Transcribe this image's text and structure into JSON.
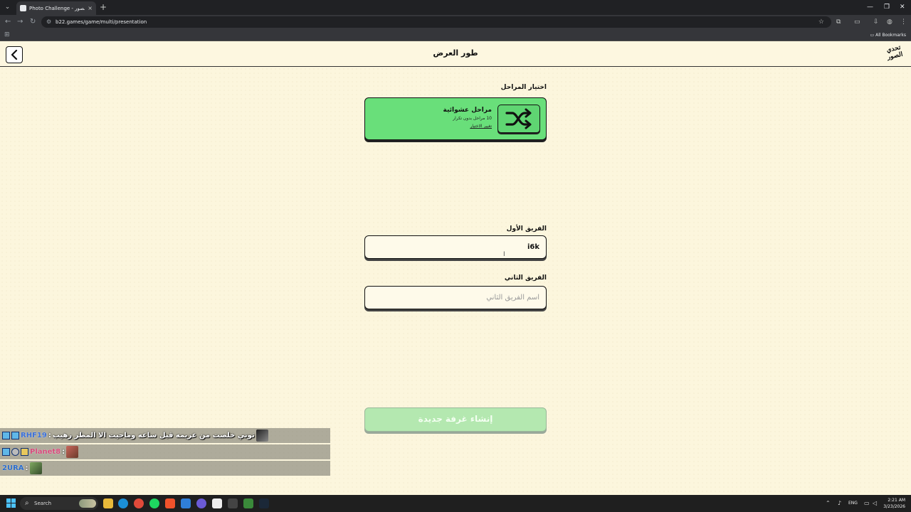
{
  "browser": {
    "tab_title": "Photo Challenge - تحدي الصور",
    "tab_close": "×",
    "new_tab": "+",
    "url": "b22.games/game/multi/presentation",
    "all_bookmarks": "All Bookmarks"
  },
  "header": {
    "title": "طور العرض",
    "logo_text": "تحدي الصور"
  },
  "levels": {
    "label": "اختيار المراحل",
    "card_title": "مراحل عشوائية",
    "card_subtitle": "10 مراحل بدون تكرار",
    "card_link": "تغيير الاختيار"
  },
  "team1": {
    "label": "الفريق الأول",
    "value": "i6k"
  },
  "team2": {
    "label": "الفريق الثاني",
    "placeholder": "اسم الفريق الثاني",
    "value": ""
  },
  "create_button": {
    "label": "إنشاء غرفة جديدة",
    "enabled": false
  },
  "chat": [
    {
      "username": "RHF19",
      "separator": ":",
      "message": "توني خلصت من عزيمه قبل ساعه وماجيت الا المطر رهيب"
    },
    {
      "username": "Planet8",
      "separator": ":",
      "message": ""
    },
    {
      "username": "2URA",
      "separator": ":",
      "message": ""
    }
  ],
  "taskbar": {
    "search_label": "Search",
    "language": "ENG",
    "time": "2:21 AM",
    "date": "3/23/2026"
  },
  "colors": {
    "page_background": "#fcf6dd",
    "card_green": "#69df7a",
    "button_disabled": "#b4e8b0"
  }
}
